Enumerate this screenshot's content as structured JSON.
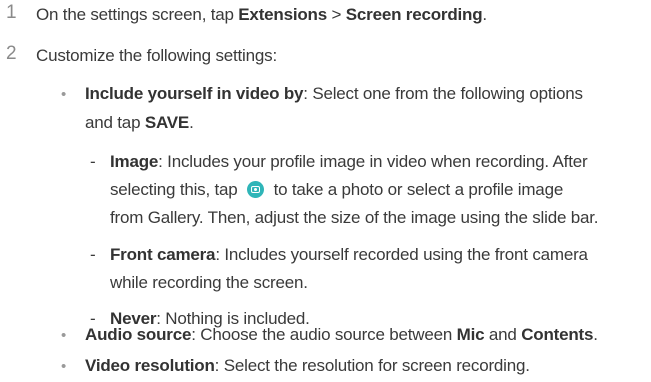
{
  "steps": [
    {
      "number": "1",
      "text_before": "On the settings screen, tap ",
      "bold1": "Extensions",
      "sep": " > ",
      "bold2": "Screen recording",
      "text_after": "."
    },
    {
      "number": "2",
      "text": "Customize the following settings:"
    }
  ],
  "bullet_glyph": "•",
  "dash_glyph": "-",
  "include_yourself": {
    "label": "Include yourself in video by",
    "desc_line1": ": Select one from the following options",
    "desc_line2_pre": "and tap ",
    "save": "SAVE",
    "desc_line2_post": "."
  },
  "image_option": {
    "label": "Image",
    "line1": ": Includes your profile image in video when recording. After",
    "line2_pre": "selecting this, tap ",
    "icon": "camera-icon",
    "line2_post": " to take a photo or select a profile image",
    "line3": "from Gallery. Then, adjust the size of the image using the slide bar."
  },
  "front_camera_option": {
    "label": "Front camera",
    "line1": ": Includes yourself recorded using the front camera",
    "line2": "while recording the screen."
  },
  "never_option": {
    "label": "Never",
    "line1": ": Nothing is included."
  },
  "audio_source": {
    "label": "Audio source",
    "text_before": ": Choose the audio source between ",
    "mic": "Mic",
    "and": " and ",
    "contents": "Contents",
    "text_after": "."
  },
  "video_resolution": {
    "label": "Video resolution",
    "text": ": Select the resolution for screen recording."
  },
  "colors": {
    "icon_teal": "#2fb5b8",
    "step_number": "#8a8a8a",
    "body_text": "#3a3a3a"
  }
}
